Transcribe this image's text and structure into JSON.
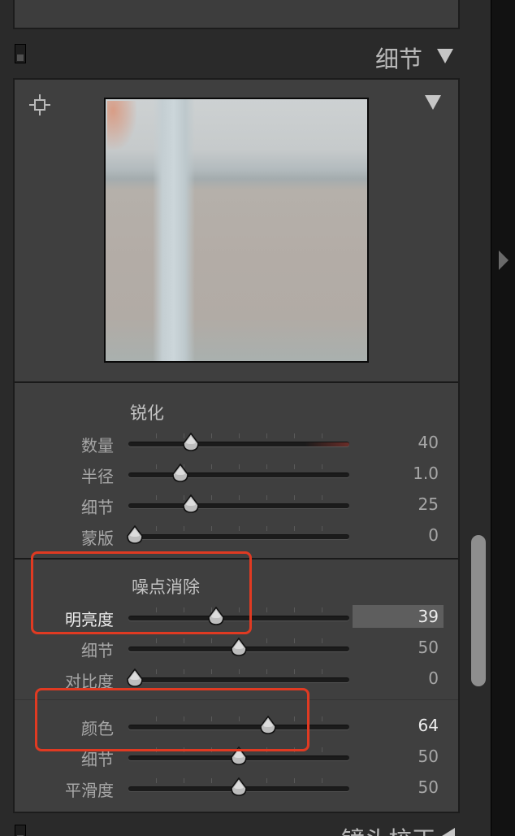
{
  "detail_panel": {
    "title": "细节",
    "sharpening": {
      "title": "锐化",
      "sliders": [
        {
          "label": "数量",
          "value": "40",
          "level": 0.27
        },
        {
          "label": "半径",
          "value": "1.0",
          "level": 0.22
        },
        {
          "label": "细节",
          "value": "25",
          "level": 0.27
        },
        {
          "label": "蒙版",
          "value": "0",
          "level": 0.0
        }
      ]
    },
    "noise_reduction": {
      "title": "噪点消除",
      "luminance": [
        {
          "label": "明亮度",
          "value": "39",
          "level": 0.39
        },
        {
          "label": "细节",
          "value": "50",
          "level": 0.5
        },
        {
          "label": "对比度",
          "value": "0",
          "level": 0.0
        }
      ],
      "color": [
        {
          "label": "颜色",
          "value": "64",
          "level": 0.64
        },
        {
          "label": "细节",
          "value": "50",
          "level": 0.5
        },
        {
          "label": "平滑度",
          "value": "50",
          "level": 0.5
        }
      ]
    }
  },
  "next_panel": {
    "title": "镜头校正"
  },
  "colors": {
    "highlight": "#e03a22",
    "panel_bg": "#3f3f3f"
  }
}
